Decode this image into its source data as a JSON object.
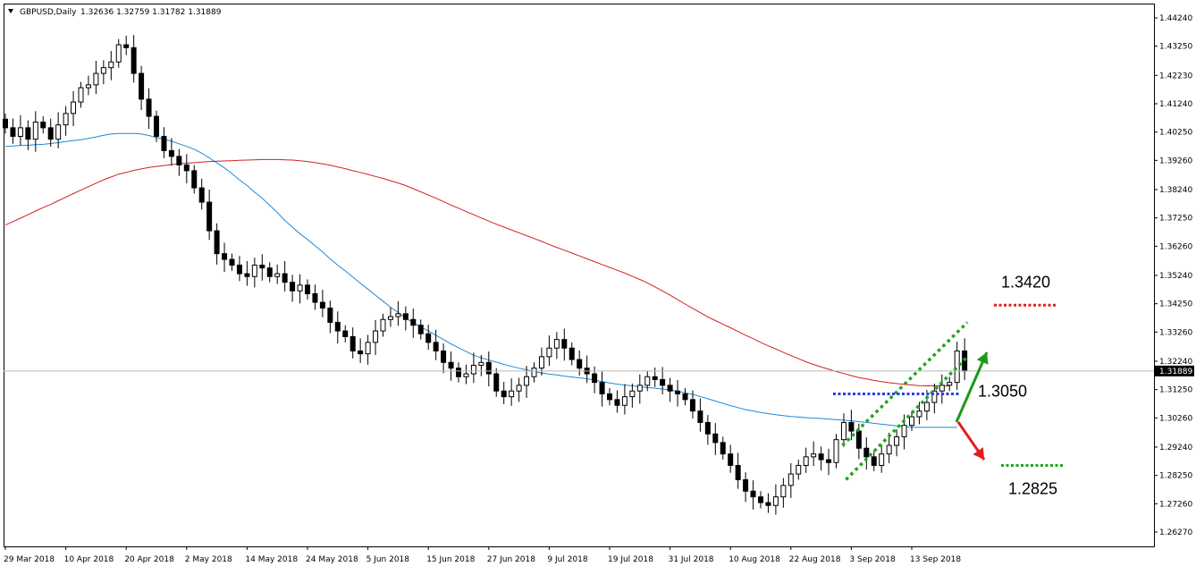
{
  "symbol_label": "GBPUSD,Daily",
  "ohlc_readout": "1.32636 1.32759 1.31782 1.31889",
  "last_price_badge": "1.31889",
  "colors": {
    "ma_fast": "#1f8ad8",
    "ma_slow": "#d42020",
    "channel": "#1fa51f",
    "resistance": "#e02020",
    "pivot": "#2a3fe0",
    "support": "#1fa51f",
    "arrow_up": "#1a9a1a",
    "arrow_down": "#e02020"
  },
  "chart_data": {
    "type": "candlestick",
    "title": "GBPUSD,Daily",
    "y_ticks": [
      "1.44240",
      "1.43250",
      "1.42230",
      "1.41240",
      "1.40250",
      "1.39260",
      "1.38240",
      "1.37250",
      "1.36260",
      "1.35240",
      "1.34250",
      "1.33260",
      "1.32240",
      "1.31250",
      "1.30260",
      "1.29240",
      "1.28250",
      "1.27260",
      "1.26270"
    ],
    "x_ticks": [
      "29 Mar 2018",
      "10 Apr 2018",
      "20 Apr 2018",
      "2 May 2018",
      "14 May 2018",
      "24 May 2018",
      "5 Jun 2018",
      "15 Jun 2018",
      "27 Jun 2018",
      "9 Jul 2018",
      "19 Jul 2018",
      "31 Jul 2018",
      "10 Aug 2018",
      "22 Aug 2018",
      "3 Sep 2018",
      "13 Sep 2018"
    ],
    "ylim": [
      1.2577,
      1.4474
    ],
    "x_tick_index": [
      0,
      8,
      16,
      24,
      32,
      40,
      48,
      56,
      64,
      72,
      80,
      88,
      96,
      104,
      112,
      120
    ],
    "closes": [
      1.404,
      1.401,
      1.404,
      1.4,
      1.406,
      1.404,
      1.4,
      1.405,
      1.409,
      1.413,
      1.418,
      1.419,
      1.423,
      1.425,
      1.427,
      1.433,
      1.432,
      1.423,
      1.414,
      1.408,
      1.401,
      1.396,
      1.394,
      1.391,
      1.389,
      1.383,
      1.378,
      1.368,
      1.36,
      1.358,
      1.356,
      1.353,
      1.352,
      1.356,
      1.355,
      1.352,
      1.353,
      1.35,
      1.347,
      1.349,
      1.346,
      1.343,
      1.341,
      1.336,
      1.333,
      1.331,
      1.326,
      1.325,
      1.329,
      1.333,
      1.337,
      1.338,
      1.339,
      1.337,
      1.335,
      1.332,
      1.329,
      1.326,
      1.322,
      1.32,
      1.317,
      1.318,
      1.321,
      1.322,
      1.318,
      1.312,
      1.31,
      1.312,
      1.314,
      1.317,
      1.32,
      1.324,
      1.327,
      1.33,
      1.327,
      1.323,
      1.32,
      1.318,
      1.315,
      1.311,
      1.309,
      1.307,
      1.31,
      1.312,
      1.314,
      1.317,
      1.316,
      1.314,
      1.312,
      1.311,
      1.309,
      1.305,
      1.301,
      1.297,
      1.294,
      1.29,
      1.286,
      1.281,
      1.277,
      1.275,
      1.273,
      1.272,
      1.275,
      1.279,
      1.283,
      1.286,
      1.289,
      1.29,
      1.288,
      1.287,
      1.295,
      1.301,
      1.298,
      1.292,
      1.289,
      1.286,
      1.29,
      1.293,
      1.296,
      1.3,
      1.303,
      1.305,
      1.308,
      1.312,
      1.314,
      1.315,
      1.326,
      1.319
    ],
    "series": [
      {
        "values": [
          1.3975,
          1.3976,
          1.3978,
          1.3979,
          1.3981,
          1.3982,
          1.3985,
          1.3988,
          1.3992,
          1.3995,
          1.3998,
          1.4003,
          1.4008,
          1.4014,
          1.4018,
          1.402,
          1.402,
          1.402,
          1.4018,
          1.4013,
          1.4006,
          1.4,
          1.3993,
          1.3984,
          1.3975,
          1.3965,
          1.3951,
          1.3935,
          1.3917,
          1.39,
          1.388,
          1.3858,
          1.3838,
          1.3815,
          1.3794,
          1.3769,
          1.3744,
          1.3716,
          1.3693,
          1.367,
          1.365,
          1.3628,
          1.3606,
          1.3582,
          1.356,
          1.354,
          1.3518,
          1.3497,
          1.3476,
          1.3455,
          1.3434,
          1.3413,
          1.3395,
          1.3375,
          1.3358,
          1.3344,
          1.333,
          1.3315,
          1.33,
          1.3285,
          1.3271,
          1.3258,
          1.3245,
          1.3236,
          1.3228,
          1.3221,
          1.3213,
          1.3206,
          1.32,
          1.3194,
          1.3188,
          1.3183,
          1.3179,
          1.3176,
          1.3172,
          1.3169,
          1.3166,
          1.3163,
          1.3158,
          1.3153,
          1.3148,
          1.3144,
          1.3141,
          1.3138,
          1.3135,
          1.3132,
          1.313,
          1.3127,
          1.3124,
          1.3119,
          1.3114,
          1.3108,
          1.3101,
          1.3093,
          1.3085,
          1.3077,
          1.3069,
          1.3062,
          1.3055,
          1.305,
          1.3045,
          1.3041,
          1.3037,
          1.3034,
          1.3031,
          1.3029,
          1.3027,
          1.3025,
          1.3024,
          1.3022,
          1.302,
          1.3018,
          1.3016,
          1.3013,
          1.301,
          1.3007,
          1.3004,
          1.3001,
          1.2998,
          1.2996,
          1.2994,
          1.2993,
          1.2993,
          1.2993,
          1.2993,
          1.2993,
          1.2993
        ]
      },
      {
        "values": [
          1.37,
          1.3712,
          1.3724,
          1.3736,
          1.3749,
          1.3761,
          1.3772,
          1.3785,
          1.3797,
          1.381,
          1.3822,
          1.3834,
          1.3846,
          1.3858,
          1.3868,
          1.3878,
          1.3884,
          1.3891,
          1.3896,
          1.3901,
          1.3905,
          1.3908,
          1.3911,
          1.3914,
          1.3916,
          1.3918,
          1.392,
          1.3922,
          1.3923,
          1.3924,
          1.3925,
          1.3926,
          1.3927,
          1.3928,
          1.3929,
          1.3929,
          1.3929,
          1.3928,
          1.3927,
          1.3925,
          1.3922,
          1.3918,
          1.3914,
          1.3909,
          1.3903,
          1.3897,
          1.389,
          1.3884,
          1.3877,
          1.387,
          1.3863,
          1.3855,
          1.3847,
          1.3838,
          1.3827,
          1.3816,
          1.3805,
          1.3794,
          1.3782,
          1.377,
          1.3759,
          1.3747,
          1.3736,
          1.3725,
          1.3714,
          1.3703,
          1.3693,
          1.3683,
          1.3673,
          1.3663,
          1.3653,
          1.3643,
          1.3632,
          1.3622,
          1.3612,
          1.3602,
          1.3592,
          1.3582,
          1.3572,
          1.3562,
          1.3552,
          1.3542,
          1.3532,
          1.3521,
          1.351,
          1.3498,
          1.3484,
          1.347,
          1.3455,
          1.344,
          1.3424,
          1.3409,
          1.3394,
          1.3379,
          1.3366,
          1.3354,
          1.3341,
          1.3328,
          1.3315,
          1.3303,
          1.329,
          1.3278,
          1.3267,
          1.3255,
          1.3244,
          1.3233,
          1.3222,
          1.3213,
          1.3204,
          1.3196,
          1.3188,
          1.3181,
          1.3174,
          1.3167,
          1.3162,
          1.3157,
          1.3153,
          1.3149,
          1.3146,
          1.3143,
          1.3141,
          1.3139,
          1.3138,
          1.3138,
          1.3138,
          1.3138
        ]
      }
    ],
    "levels": [
      {
        "label": "1.3420",
        "value": 1.342,
        "role": "resistance"
      },
      {
        "label": "1.3050",
        "value": 1.311,
        "role": "pivot"
      },
      {
        "label": "1.2825",
        "value": 1.286,
        "role": "support"
      }
    ],
    "channel": {
      "start_index": 112,
      "end_index": 125,
      "upper_start": 1.293,
      "upper_end": 1.336,
      "lower_start": 1.281,
      "lower_end": 1.324
    },
    "grid": false,
    "legend": "none"
  }
}
